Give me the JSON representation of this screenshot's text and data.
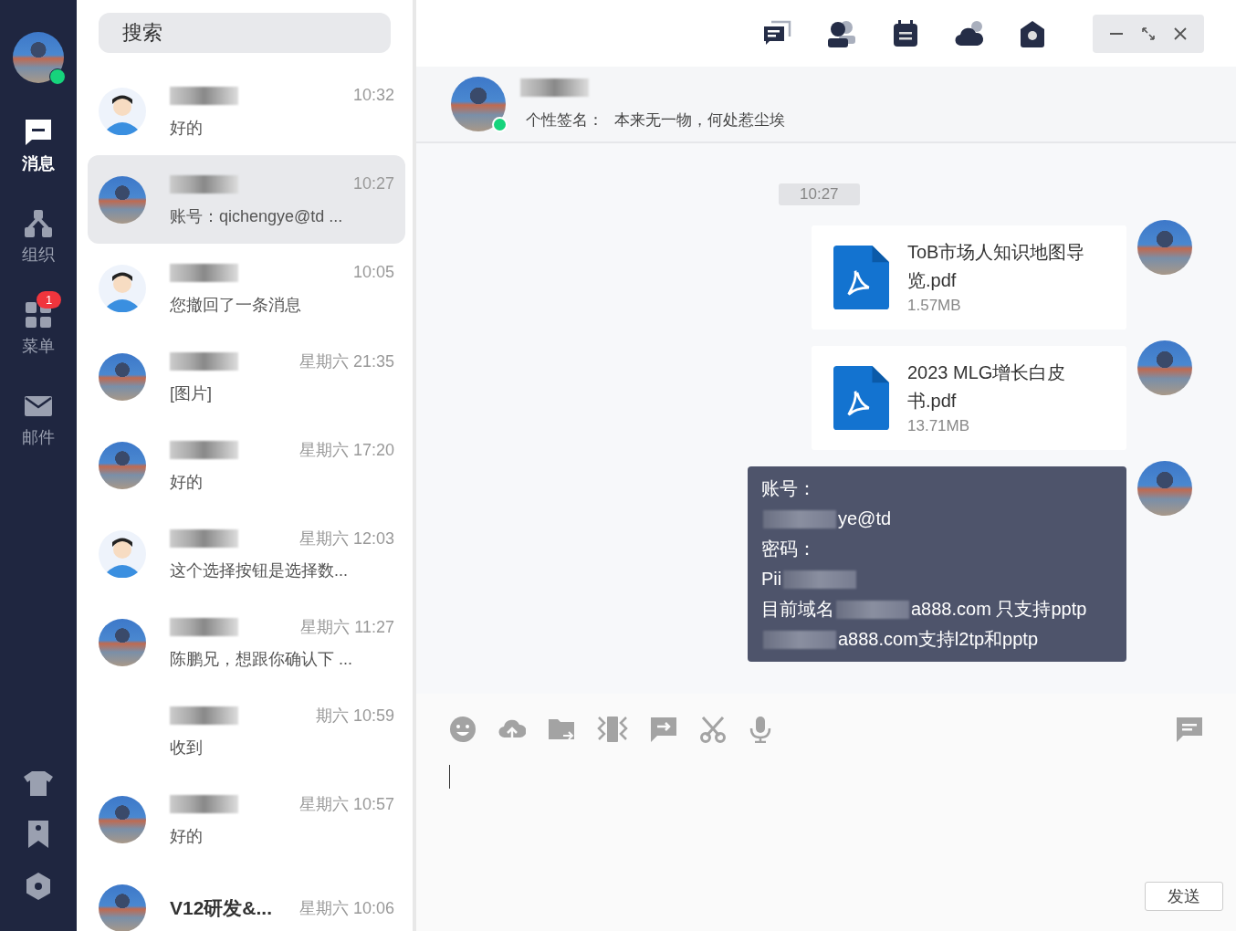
{
  "sidebar": {
    "user": {
      "online": true
    },
    "nav": [
      {
        "kind": "chat",
        "label": "消息",
        "selected": true
      },
      {
        "kind": "org",
        "label": "组织",
        "selected": false
      },
      {
        "kind": "grid",
        "label": "菜单",
        "selected": false,
        "badge": "1"
      },
      {
        "kind": "mail",
        "label": "邮件",
        "selected": false
      }
    ],
    "bottom_icons": [
      {
        "kind": "shirt"
      },
      {
        "kind": "bookmark"
      },
      {
        "kind": "hexagon"
      }
    ]
  },
  "search": {
    "placeholder": "搜索"
  },
  "conversations": [
    {
      "kind": "cartoon",
      "time": "10:32",
      "preview": "好的",
      "selected": false
    },
    {
      "kind": "photo",
      "time": "10:27",
      "preview": "账号：qichengye@td ...",
      "selected": true
    },
    {
      "kind": "cartoon",
      "time": "10:05",
      "preview": "您撤回了一条消息",
      "selected": false
    },
    {
      "kind": "photo",
      "time": "星期六 21:35",
      "preview": "[图片]",
      "selected": false
    },
    {
      "kind": "photo",
      "time": "星期六 17:20",
      "preview": "好的",
      "selected": false
    },
    {
      "kind": "cartoon",
      "time": "星期六 12:03",
      "preview": "这个选择按钮是选择数...",
      "selected": false
    },
    {
      "kind": "photo",
      "time": "星期六 11:27",
      "preview": "陈鹏兄，想跟你确认下 ...",
      "selected": false
    },
    {
      "kind": "none",
      "time": "期六 10:59",
      "preview": "收到",
      "selected": false
    },
    {
      "kind": "photo",
      "time": "星期六 10:57",
      "preview": "好的",
      "selected": false
    },
    {
      "kind": "photo",
      "name": "V12研发&...",
      "time": "星期六 10:06",
      "selected": false
    }
  ],
  "top_icons": [
    {
      "kind": "chats"
    },
    {
      "kind": "contacts"
    },
    {
      "kind": "calendar"
    },
    {
      "kind": "cloud"
    },
    {
      "kind": "home"
    }
  ],
  "chat": {
    "header": {
      "online": true,
      "signature_label": "个性签名：",
      "signature": "本来无一物，何处惹尘埃"
    },
    "time_divider": "10:27",
    "messages": [
      {
        "kind": "file",
        "filename": "ToB市场人知识地图导览.pdf",
        "size": "1.57MB"
      },
      {
        "kind": "file",
        "filename": "2023 MLG增长白皮书.pdf",
        "size": "13.71MB"
      },
      {
        "kind": "text",
        "lines": [
          [
            {
              "kind": "text",
              "text": "账号："
            }
          ],
          [
            {
              "kind": "blur"
            },
            {
              "kind": "text",
              "text": "ye@td"
            }
          ],
          [
            {
              "kind": "text",
              "text": "密码："
            }
          ],
          [
            {
              "kind": "text",
              "text": "Pii"
            },
            {
              "kind": "blur"
            }
          ],
          [
            {
              "kind": "text",
              "text": "目前域名"
            },
            {
              "kind": "blur"
            },
            {
              "kind": "text",
              "text": "a888.com 只支持pptp"
            }
          ],
          [
            {
              "kind": "blur"
            },
            {
              "kind": "text",
              "text": "a888.com支持l2tp和pptp"
            }
          ]
        ]
      }
    ],
    "toolbar": [
      {
        "kind": "emoji"
      },
      {
        "kind": "upload"
      },
      {
        "kind": "folder"
      },
      {
        "kind": "screenshot"
      },
      {
        "kind": "forward"
      },
      {
        "kind": "scissors"
      },
      {
        "kind": "microphone"
      }
    ],
    "send_label": "发送"
  }
}
